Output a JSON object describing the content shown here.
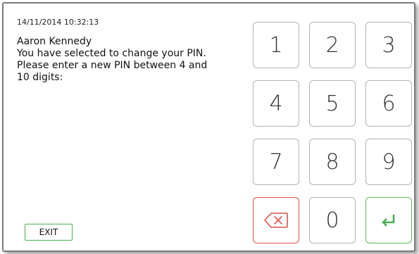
{
  "header": {
    "timestamp": "14/11/2014 10:32:13"
  },
  "message": {
    "user_name": "Aaron Kennedy",
    "lines": [
      "You have selected to change your PIN.",
      "Please enter a new PIN between 4 and",
      "10 digits:"
    ]
  },
  "keypad": {
    "keys": [
      "1",
      "2",
      "3",
      "4",
      "5",
      "6",
      "7",
      "8",
      "9",
      "0"
    ],
    "backspace_icon": "backspace-icon",
    "enter_icon": "enter-icon"
  },
  "footer": {
    "exit_label": "EXIT"
  },
  "colors": {
    "backspace": "#d9534f",
    "enter": "#4caf50",
    "exit_border": "#4caf50"
  }
}
